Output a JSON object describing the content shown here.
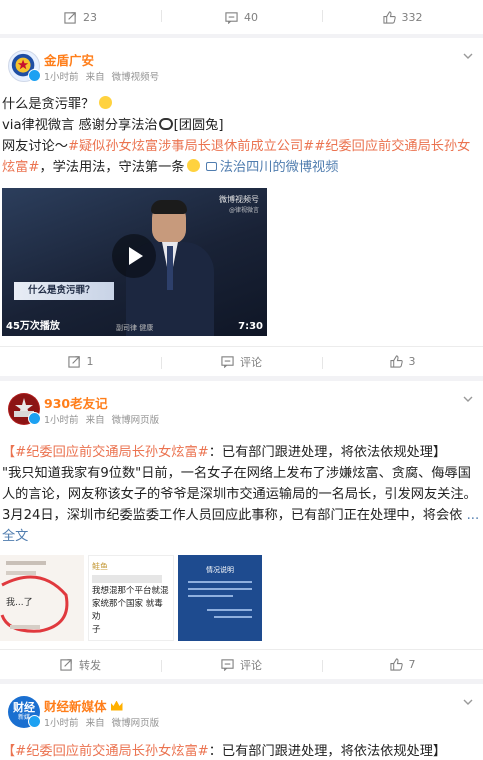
{
  "top_actions": {
    "share_count": "23",
    "comment_count": "40",
    "like_count": "332"
  },
  "post1": {
    "author": "金盾广安",
    "time": "1小时前",
    "source_prefix": "来自",
    "source": "微博视频号",
    "line1": "什么是贪污罪？",
    "line2": "via律视微言 感谢分享法治",
    "line2_tag": "[团圆兔]",
    "line3_prefix": "网友讨论～",
    "hashtag1": "#疑似孙女炫富涉事局长退休前成立公司#",
    "hashtag2": "#纪委回应前交通局长孙女炫富#",
    "line3_mid": "，学法用法，守法第一条",
    "video_link": "法治四川的微博视频",
    "video": {
      "plays": "45万次播放",
      "duration": "7:30",
      "caption": "什么是贪污罪？",
      "watermark": "微博视频号",
      "watermark_sub": "@律视微言",
      "presenter": "副司律 健康"
    },
    "actions": {
      "share": "1",
      "comment": "评论",
      "like": "3"
    }
  },
  "post2": {
    "author": "930老友记",
    "time": "1小时前",
    "source_prefix": "来自",
    "source": "微博网页版",
    "hashtag": "【#纪委回应前交通局长孙女炫富#",
    "title_rest": "：已有部门跟进处理，将依法依规处理】",
    "body": "\"我只知道我家有9位数\"日前，一名女子在网络上发布了涉嫌炫富、贪腐、侮辱国人的言论，网友称该女子的爷爷是深圳市交通运输局的一名局长，引发网友关注。3月24日，深圳市纪委监委工作人员回应此事称，已有部门正在处理中，将会依",
    "more": "...全文",
    "images": {
      "img1_text": "我...了",
      "img2_name": "鲑鱼",
      "img2_line1": "我想混那个平台就混",
      "img2_line2": "家统那个国家 就毒劝",
      "img2_line3": "子",
      "img3_title": "情况说明"
    },
    "actions": {
      "share": "转发",
      "comment": "评论",
      "like": "7"
    }
  },
  "post3": {
    "author": "财经新媒体",
    "time": "1小时前",
    "source_prefix": "来自",
    "source": "微博网页版",
    "avatar_text": "财经",
    "avatar_sub": "新媒",
    "hashtag": "【#纪委回应前交通局长孙女炫富#",
    "title_rest": "：已有部门跟进处理，将依法依规处理】"
  },
  "colors": {
    "accent": "#eb7350",
    "name": "#ff7e1a",
    "link_blue": "#507daf"
  }
}
